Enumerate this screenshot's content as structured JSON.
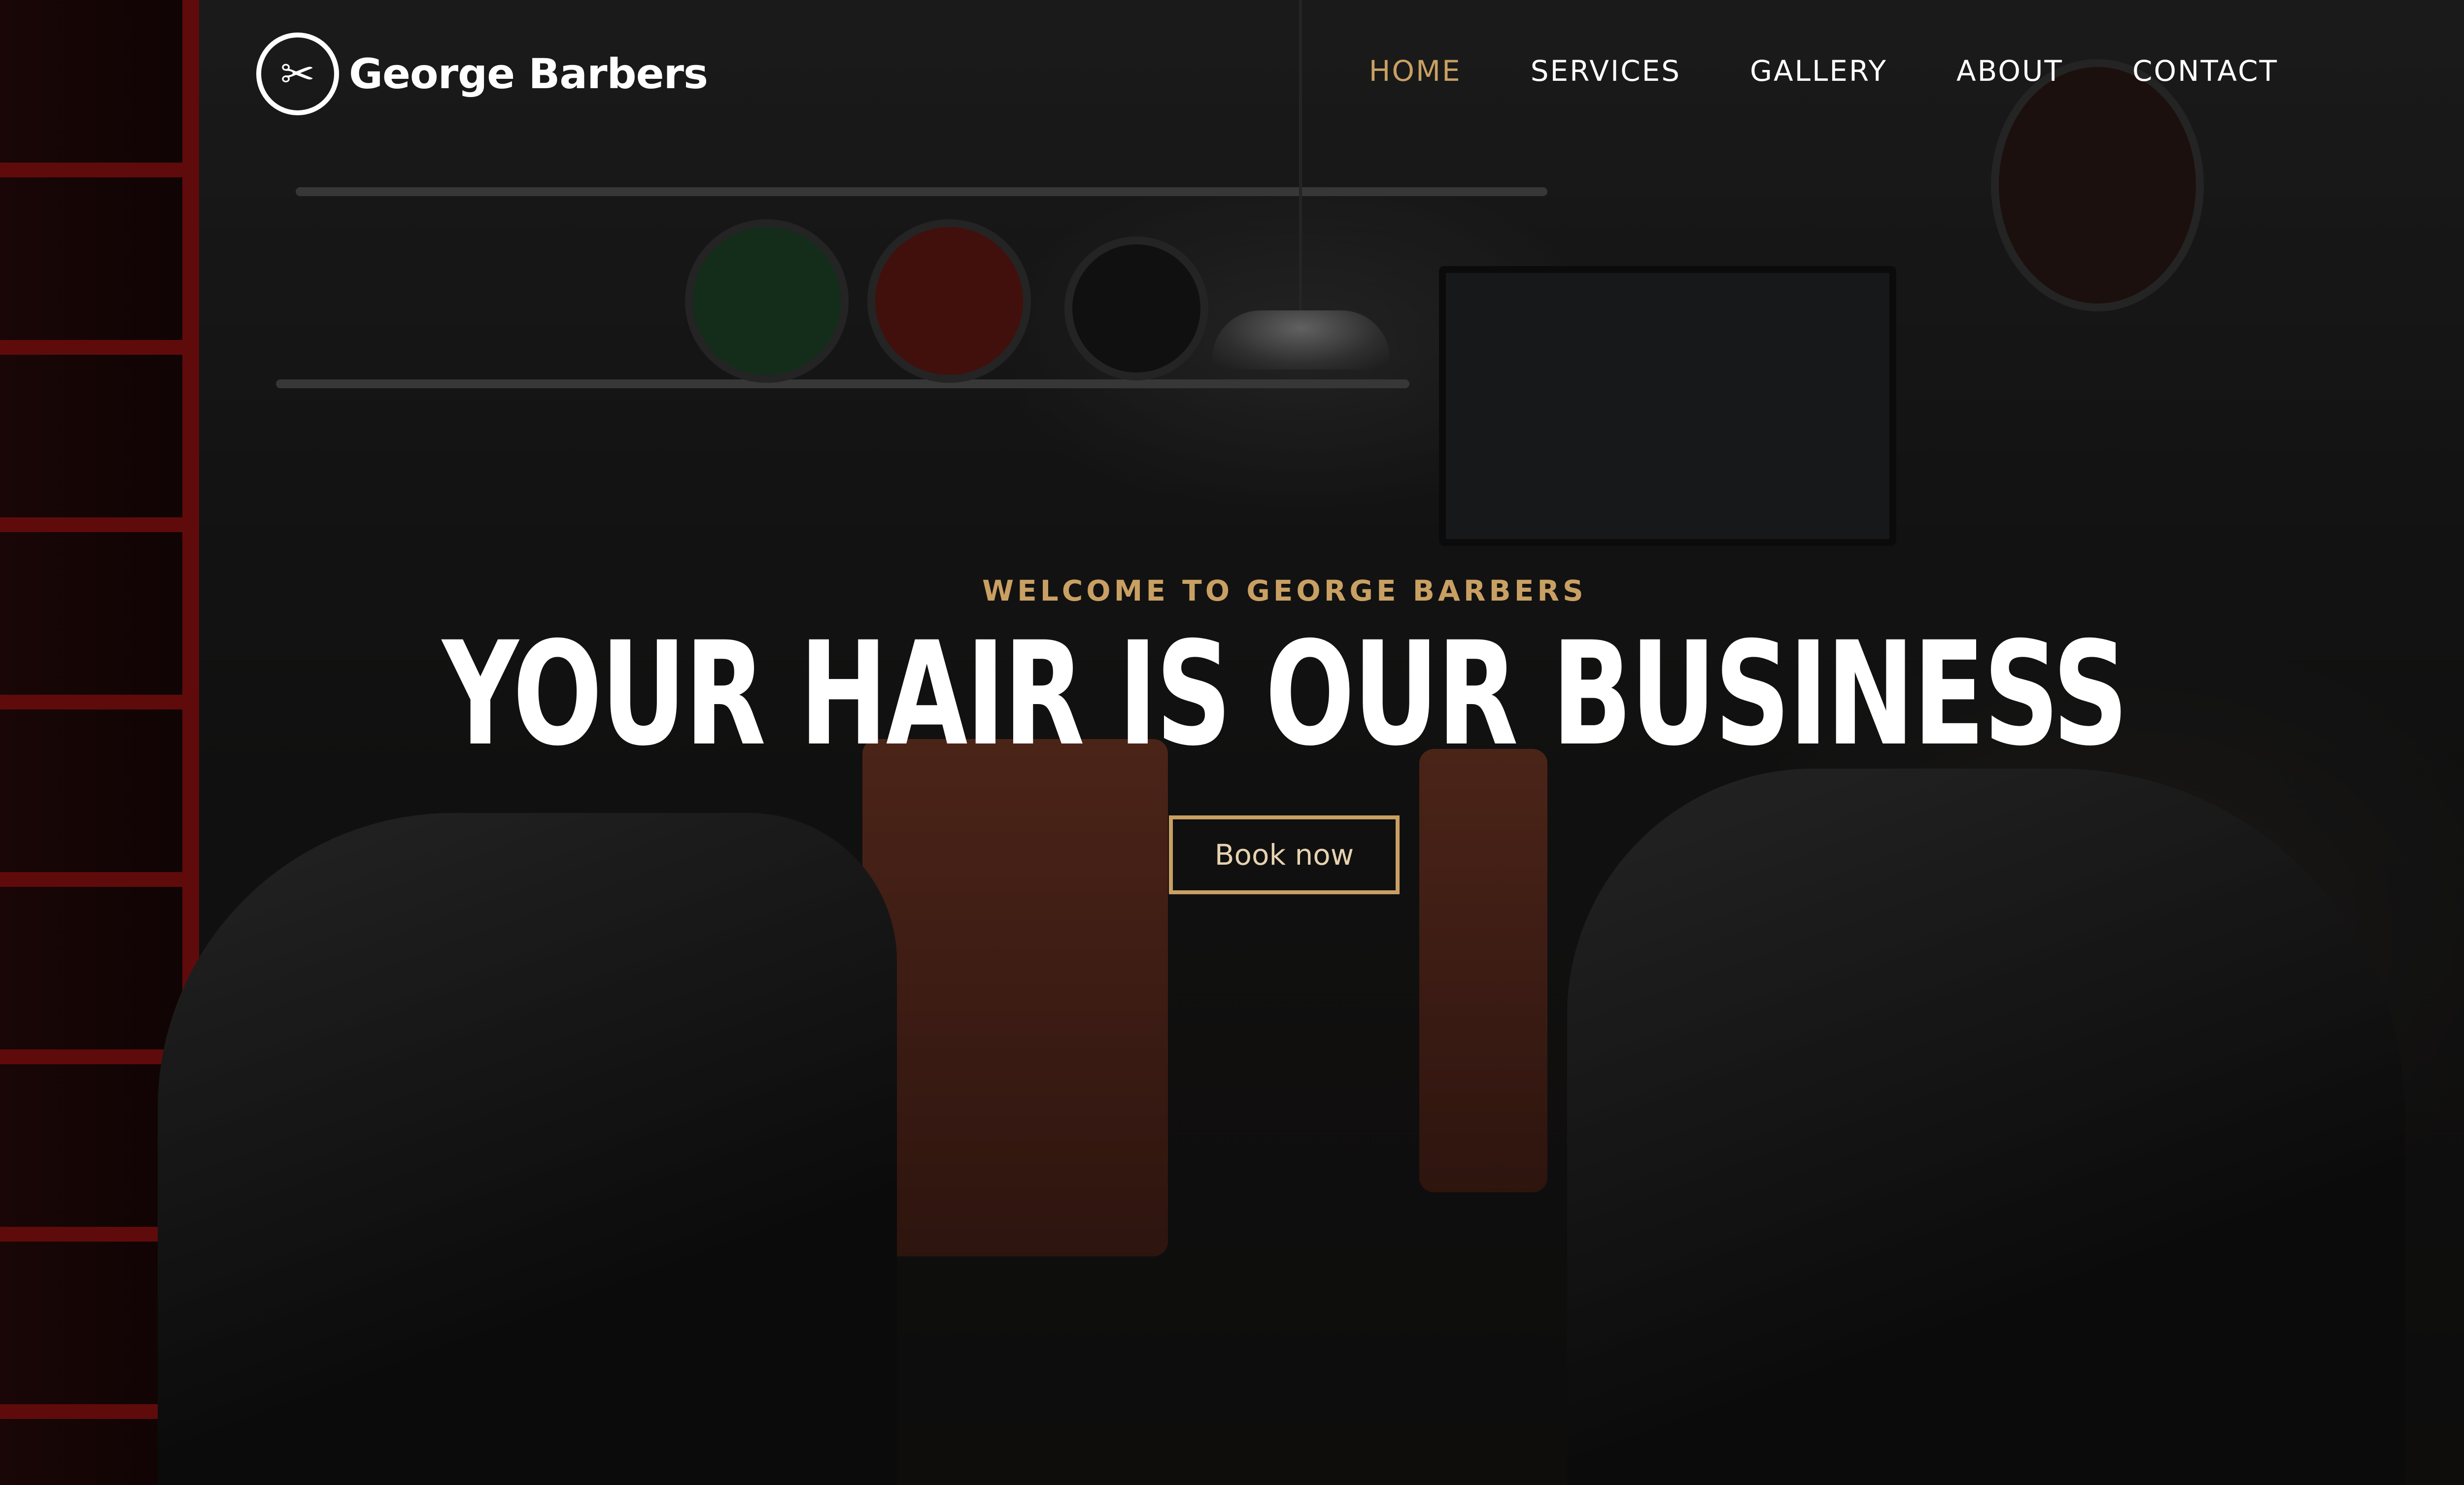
{
  "brand": {
    "name": "George Barbers",
    "logo_icon": "scissors-icon"
  },
  "nav": {
    "items": [
      {
        "label": "HOME",
        "active": true
      },
      {
        "label": "SERVICES",
        "active": false
      },
      {
        "label": "GALLERY",
        "active": false
      },
      {
        "label": "ABOUT",
        "active": false
      },
      {
        "label": "CONTACT",
        "active": false
      }
    ]
  },
  "hero": {
    "welcome": "WELCOME TO GEORGE BARBERS",
    "headline": "YOUR HAIR IS OUR BUSINESS",
    "cta_label": "Book now"
  },
  "colors": {
    "accent": "#c9a063",
    "text": "#ffffff",
    "overlay": "#000000"
  }
}
